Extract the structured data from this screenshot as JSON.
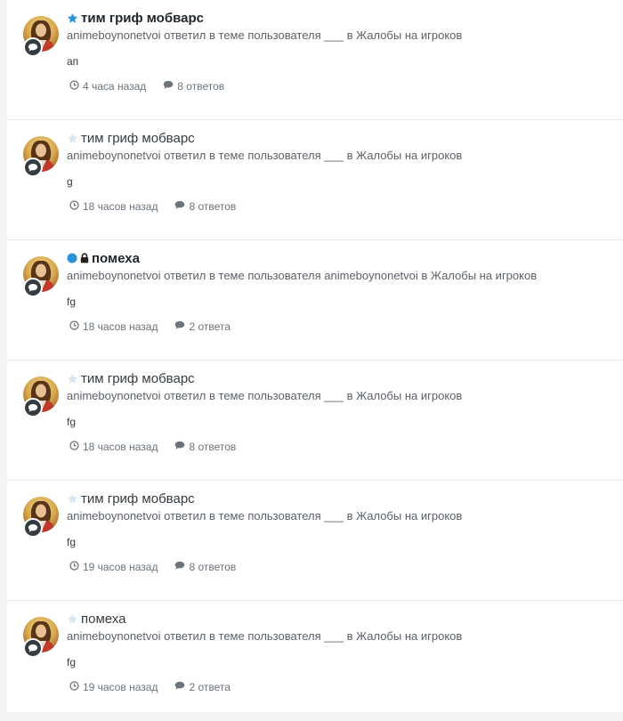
{
  "colors": {
    "accent_blue": "#2b92d6",
    "muted_star": "#d8e6f2",
    "badge_bg": "#353c41",
    "text_main": "#353c41",
    "text_meta": "#6b737b"
  },
  "items": [
    {
      "title": "тим гриф мобварс",
      "title_bold": true,
      "icons": [
        "star-filled-icon"
      ],
      "activity": "animeboynonetvoi ответил в теме пользователя ___ в Жалобы на игроков",
      "snippet": "ап",
      "time": "4 часа назад",
      "replies": "8 ответов"
    },
    {
      "title": "тим гриф мобварс",
      "title_bold": false,
      "icons": [
        "star-outline-icon"
      ],
      "activity": "animeboynonetvoi ответил в теме пользователя ___ в Жалобы на игроков",
      "snippet": "g",
      "time": "18 часов назад",
      "replies": "8 ответов"
    },
    {
      "title": "помеха",
      "title_bold": true,
      "icons": [
        "unread-dot-icon",
        "lock-icon"
      ],
      "activity": "animeboynonetvoi ответил в теме пользователя animeboynonetvoi в Жалобы на игроков",
      "snippet": "fg",
      "time": "18 часов назад",
      "replies": "2 ответа"
    },
    {
      "title": "тим гриф мобварс",
      "title_bold": false,
      "icons": [
        "star-outline-icon"
      ],
      "activity": "animeboynonetvoi ответил в теме пользователя ___ в Жалобы на игроков",
      "snippet": "fg",
      "time": "18 часов назад",
      "replies": "8 ответов"
    },
    {
      "title": "тим гриф мобварс",
      "title_bold": false,
      "icons": [
        "star-outline-icon"
      ],
      "activity": "animeboynonetvoi ответил в теме пользователя ___ в Жалобы на игроков",
      "snippet": "fg",
      "time": "19 часов назад",
      "replies": "8 ответов"
    },
    {
      "title": "помеха",
      "title_bold": false,
      "icons": [
        "star-outline-icon"
      ],
      "activity": "animeboynonetvoi ответил в теме пользователя ___ в Жалобы на игроков",
      "snippet": "fg",
      "time": "19 часов назад",
      "replies": "2 ответа"
    }
  ]
}
